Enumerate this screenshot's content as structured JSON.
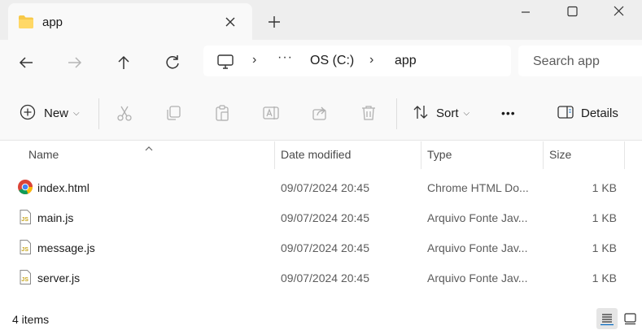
{
  "window": {
    "tab_title": "app",
    "new_tab_label": "+"
  },
  "nav": {
    "breadcrumb_more": "···",
    "breadcrumb": [
      "OS (C:)",
      "app"
    ],
    "search_placeholder": "Search app"
  },
  "command_bar": {
    "new_label": "New",
    "sort_label": "Sort",
    "more_label": "•••",
    "details_label": "Details"
  },
  "columns": [
    "Name",
    "Date modified",
    "Type",
    "Size"
  ],
  "files": [
    {
      "name": "index.html",
      "date": "09/07/2024 20:45",
      "type": "Chrome HTML Do...",
      "size": "1 KB",
      "icon": "chrome-icon"
    },
    {
      "name": "main.js",
      "date": "09/07/2024 20:45",
      "type": "Arquivo Fonte Jav...",
      "size": "1 KB",
      "icon": "js-file-icon"
    },
    {
      "name": "message.js",
      "date": "09/07/2024 20:45",
      "type": "Arquivo Fonte Jav...",
      "size": "1 KB",
      "icon": "js-file-icon"
    },
    {
      "name": "server.js",
      "date": "09/07/2024 20:45",
      "type": "Arquivo Fonte Jav...",
      "size": "1 KB",
      "icon": "js-file-icon"
    }
  ],
  "status": {
    "item_count": "4 items"
  },
  "colors": {
    "accent": "#0067c0",
    "folder_yellow": "#f7c948",
    "js_icon": "#c7a51d"
  }
}
